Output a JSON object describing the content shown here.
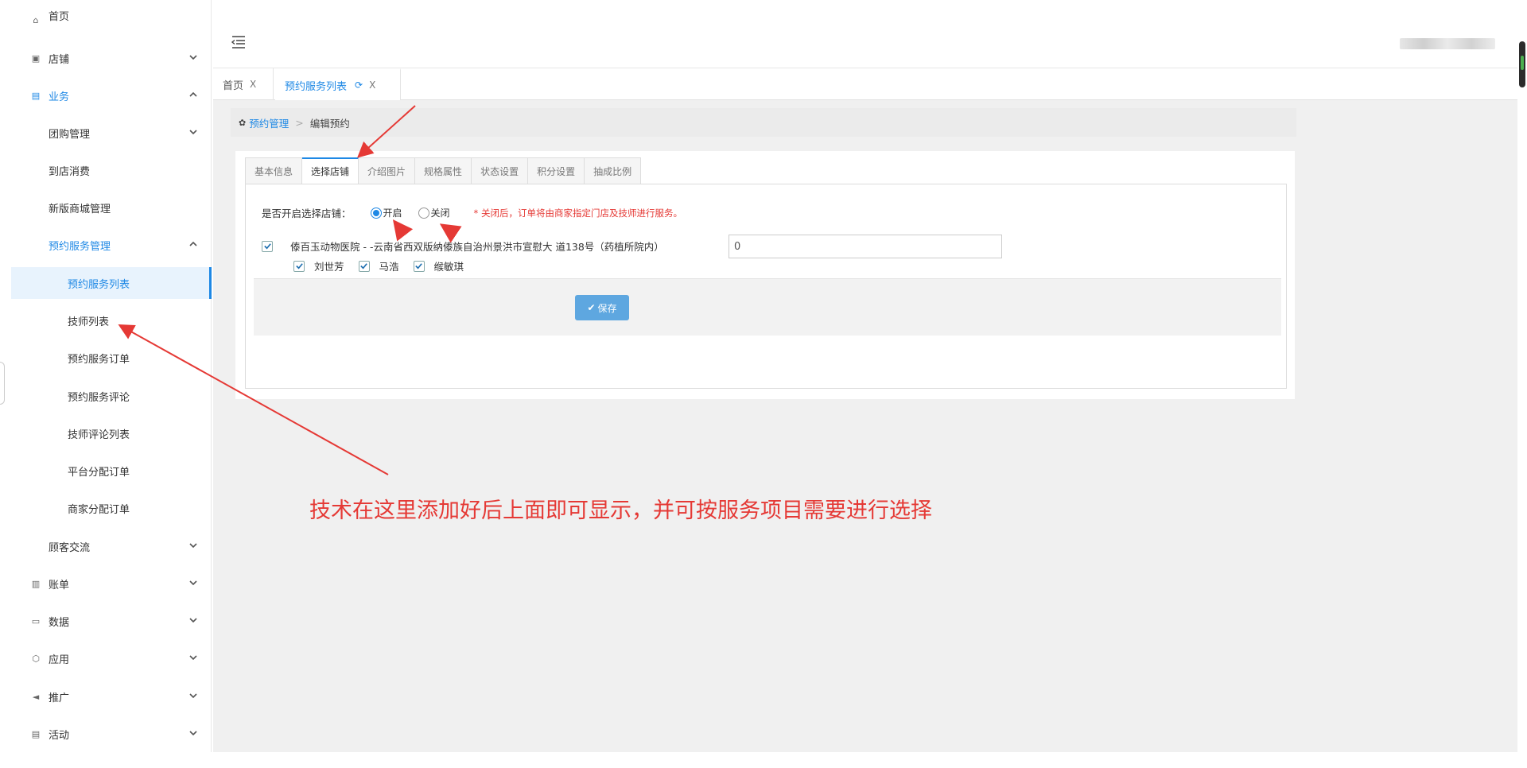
{
  "sidebar": {
    "items": [
      {
        "label": "首页",
        "icon": "home-icon"
      },
      {
        "label": "店铺",
        "icon": "store-icon"
      },
      {
        "label": "业务",
        "icon": "business-icon"
      },
      {
        "label": "团购管理"
      },
      {
        "label": "到店消费"
      },
      {
        "label": "新版商城管理"
      },
      {
        "label": "预约服务管理"
      },
      {
        "label": "预约服务列表"
      },
      {
        "label": "技师列表"
      },
      {
        "label": "预约服务订单"
      },
      {
        "label": "预约服务评论"
      },
      {
        "label": "技师评论列表"
      },
      {
        "label": "平台分配订单"
      },
      {
        "label": "商家分配订单"
      },
      {
        "label": "顾客交流"
      },
      {
        "label": "账单",
        "icon": "bill-icon"
      },
      {
        "label": "数据",
        "icon": "data-icon"
      },
      {
        "label": "应用",
        "icon": "app-icon"
      },
      {
        "label": "推广",
        "icon": "megaphone-icon"
      },
      {
        "label": "活动",
        "icon": "activity-icon"
      }
    ]
  },
  "tabs": [
    {
      "label": "首页",
      "close": "X"
    },
    {
      "label": "预约服务列表",
      "close": "X"
    }
  ],
  "breadcrumb": {
    "parent": "预约管理",
    "separator": ">",
    "current": "编辑预约"
  },
  "form_tabs": [
    "基本信息",
    "选择店铺",
    "介绍图片",
    "规格属性",
    "状态设置",
    "积分设置",
    "抽成比例"
  ],
  "form": {
    "question": "是否开启选择店铺：",
    "option_on": "开启",
    "option_off": "关闭",
    "warning": "* 关闭后，订单将由商家指定门店及技师进行服务。",
    "store_label": "傣百玉动物医院 - -云南省西双版纳傣族自治州景洪市宣慰大 道138号（药植所院内）",
    "store_value": "0",
    "technicians": [
      "刘世芳",
      "马浩",
      "缑敏琪"
    ],
    "save_label": "保存"
  },
  "annotation": "技术在这里添加好后上面即可显示，并可按服务项目需要进行选择",
  "colors": {
    "accent": "#1e88e5",
    "annotation": "#e53935",
    "save_button": "#5ea7e0"
  }
}
